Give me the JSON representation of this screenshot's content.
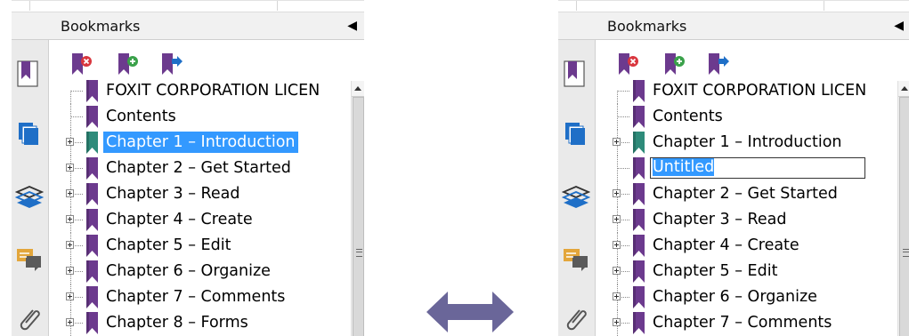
{
  "panels": [
    {
      "title": "Bookmarks",
      "collapse_glyph": "◀",
      "toolbar": [
        "delete-bookmark-icon",
        "add-bookmark-icon",
        "move-bookmark-icon"
      ],
      "sidebar_icons": [
        "bookmarks-icon",
        "pages-icon",
        "layers-icon",
        "comments-icon",
        "attachments-icon"
      ],
      "items": [
        {
          "label": "FOXIT CORPORATION LICEN",
          "expandable": false,
          "state": "normal",
          "color": "purple"
        },
        {
          "label": "Contents",
          "expandable": false,
          "state": "normal",
          "color": "purple"
        },
        {
          "label": "Chapter 1 – Introduction",
          "expandable": true,
          "state": "selected",
          "color": "teal"
        },
        {
          "label": "Chapter 2 – Get Started",
          "expandable": true,
          "state": "normal",
          "color": "purple"
        },
        {
          "label": "Chapter 3 – Read",
          "expandable": true,
          "state": "normal",
          "color": "purple"
        },
        {
          "label": "Chapter 4 – Create",
          "expandable": true,
          "state": "normal",
          "color": "purple"
        },
        {
          "label": "Chapter 5 – Edit",
          "expandable": true,
          "state": "normal",
          "color": "purple"
        },
        {
          "label": "Chapter 6 – Organize",
          "expandable": true,
          "state": "normal",
          "color": "purple"
        },
        {
          "label": "Chapter 7 – Comments",
          "expandable": true,
          "state": "normal",
          "color": "purple"
        },
        {
          "label": "Chapter 8 – Forms",
          "expandable": true,
          "state": "normal",
          "color": "purple"
        }
      ]
    },
    {
      "title": "Bookmarks",
      "collapse_glyph": "◀",
      "toolbar": [
        "delete-bookmark-icon",
        "add-bookmark-icon",
        "move-bookmark-icon"
      ],
      "sidebar_icons": [
        "bookmarks-icon",
        "pages-icon",
        "layers-icon",
        "comments-icon",
        "attachments-icon"
      ],
      "items": [
        {
          "label": "FOXIT CORPORATION LICEN",
          "expandable": false,
          "state": "normal",
          "color": "purple"
        },
        {
          "label": "Contents",
          "expandable": false,
          "state": "normal",
          "color": "purple"
        },
        {
          "label": "Chapter 1 – Introduction",
          "expandable": true,
          "state": "normal",
          "color": "teal"
        },
        {
          "label": "Untitled",
          "expandable": false,
          "state": "editing",
          "color": "purple"
        },
        {
          "label": "Chapter 2 – Get Started",
          "expandable": true,
          "state": "normal",
          "color": "purple"
        },
        {
          "label": "Chapter 3 – Read",
          "expandable": true,
          "state": "normal",
          "color": "purple"
        },
        {
          "label": "Chapter 4 – Create",
          "expandable": true,
          "state": "normal",
          "color": "purple"
        },
        {
          "label": "Chapter 5 – Edit",
          "expandable": true,
          "state": "normal",
          "color": "purple"
        },
        {
          "label": "Chapter 6 – Organize",
          "expandable": true,
          "state": "normal",
          "color": "purple"
        },
        {
          "label": "Chapter 7 – Comments",
          "expandable": true,
          "state": "normal",
          "color": "purple"
        }
      ]
    }
  ],
  "colors": {
    "bookmark_purple": "#6c3a8e",
    "bookmark_teal": "#2e8b7a",
    "selection": "#3399ff",
    "arrow": "#6a6699",
    "pages_blue": "#1f6fc7",
    "comment_orange": "#e3a63b"
  },
  "center_icon": "double-arrow-icon"
}
